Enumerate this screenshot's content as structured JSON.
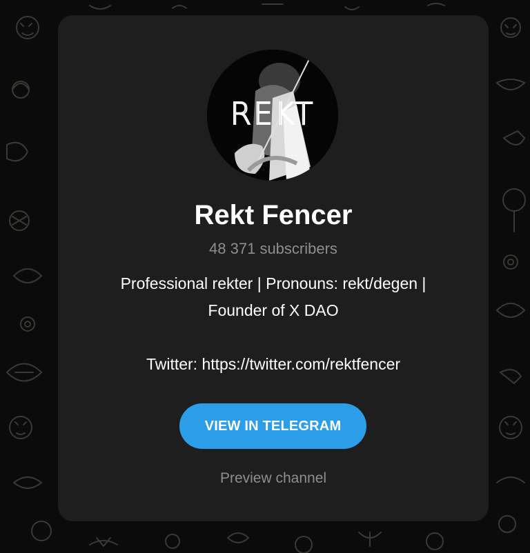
{
  "channel": {
    "avatar_text": "REKT",
    "name": "Rekt Fencer",
    "subscribers": "48 371 subscribers",
    "description_lines": [
      "Professional rekter | Pronouns: rekt/degen |",
      "Founder of X DAO",
      "",
      "Twitter: https://twitter.com/rektfencer"
    ]
  },
  "actions": {
    "view_button_label": "VIEW IN TELEGRAM",
    "preview_label": "Preview channel"
  },
  "colors": {
    "background": "#0b0b0b",
    "card": "#1e1e1e",
    "accent": "#2b9de9",
    "muted_text": "#8e8e8e",
    "text": "#ffffff"
  },
  "icons": {
    "background_pattern": "telegram-doodle-pattern-icon"
  }
}
